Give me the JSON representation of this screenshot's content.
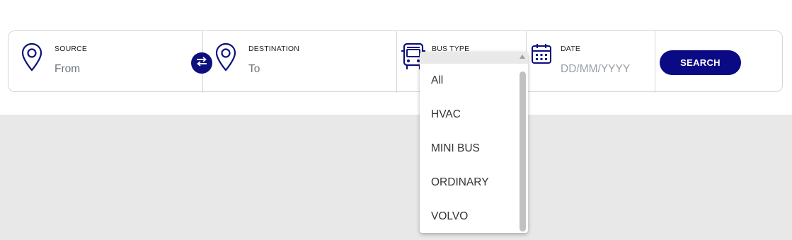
{
  "search_bar": {
    "source": {
      "label": "SOURCE",
      "placeholder": "From",
      "icon": "location-pin-icon"
    },
    "swap": {
      "icon": "swap-arrows-icon"
    },
    "destination": {
      "label": "DESTINATION",
      "placeholder": "To",
      "icon": "location-pin-icon"
    },
    "bus_type": {
      "label": "BUS TYPE",
      "icon": "bus-icon"
    },
    "date": {
      "label": "DATE",
      "placeholder": "DD/MM/YYYY",
      "icon": "calendar-icon"
    },
    "search_button": {
      "label": "SEARCH"
    }
  },
  "bus_type_dropdown": {
    "options": [
      "All",
      "HVAC",
      "MINI BUS",
      "ORDINARY",
      "VOLVO"
    ]
  },
  "colors": {
    "brand_navy": "#0a0a85",
    "border": "#d6d6d6",
    "band_gray": "#e8e8e8"
  }
}
